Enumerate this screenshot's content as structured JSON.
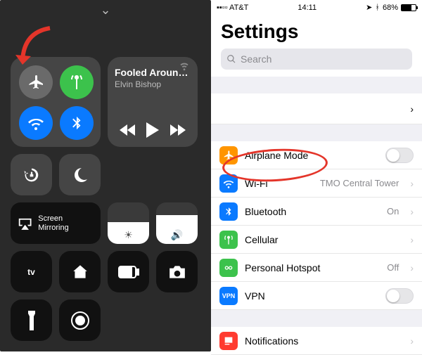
{
  "left": {
    "music": {
      "title": "Fooled Around...",
      "artist": "Elvin Bishop"
    },
    "screen_mirroring": "Screen\nMirroring",
    "icons": {
      "airplane": "airplane-icon",
      "cellular_antenna": "antenna-icon",
      "wifi": "wifi-icon",
      "bluetooth": "bluetooth-icon",
      "lock": "orientation-lock-icon",
      "dnd": "moon-icon",
      "airplay": "airplay-icon",
      "brightness": "sun-icon",
      "volume": "speaker-icon",
      "appletv": "apple-tv-icon",
      "home": "homekit-icon",
      "battery": "battery-panel-icon",
      "camera": "camera-icon",
      "flashlight": "flashlight-icon",
      "record": "screen-record-icon"
    }
  },
  "right": {
    "status": {
      "carrier": "AT&T",
      "time": "14:11",
      "battery_pct": "68%"
    },
    "title": "Settings",
    "search_placeholder": "Search",
    "rows": {
      "airplane": {
        "label": "Airplane Mode"
      },
      "wifi": {
        "label": "Wi-Fi",
        "value": "TMO Central Tower"
      },
      "bluetooth": {
        "label": "Bluetooth",
        "value": "On"
      },
      "cellular": {
        "label": "Cellular"
      },
      "hotspot": {
        "label": "Personal Hotspot",
        "value": "Off"
      },
      "vpn": {
        "label": "VPN"
      },
      "notifications": {
        "label": "Notifications"
      }
    },
    "vpn_badge": "VPN"
  }
}
